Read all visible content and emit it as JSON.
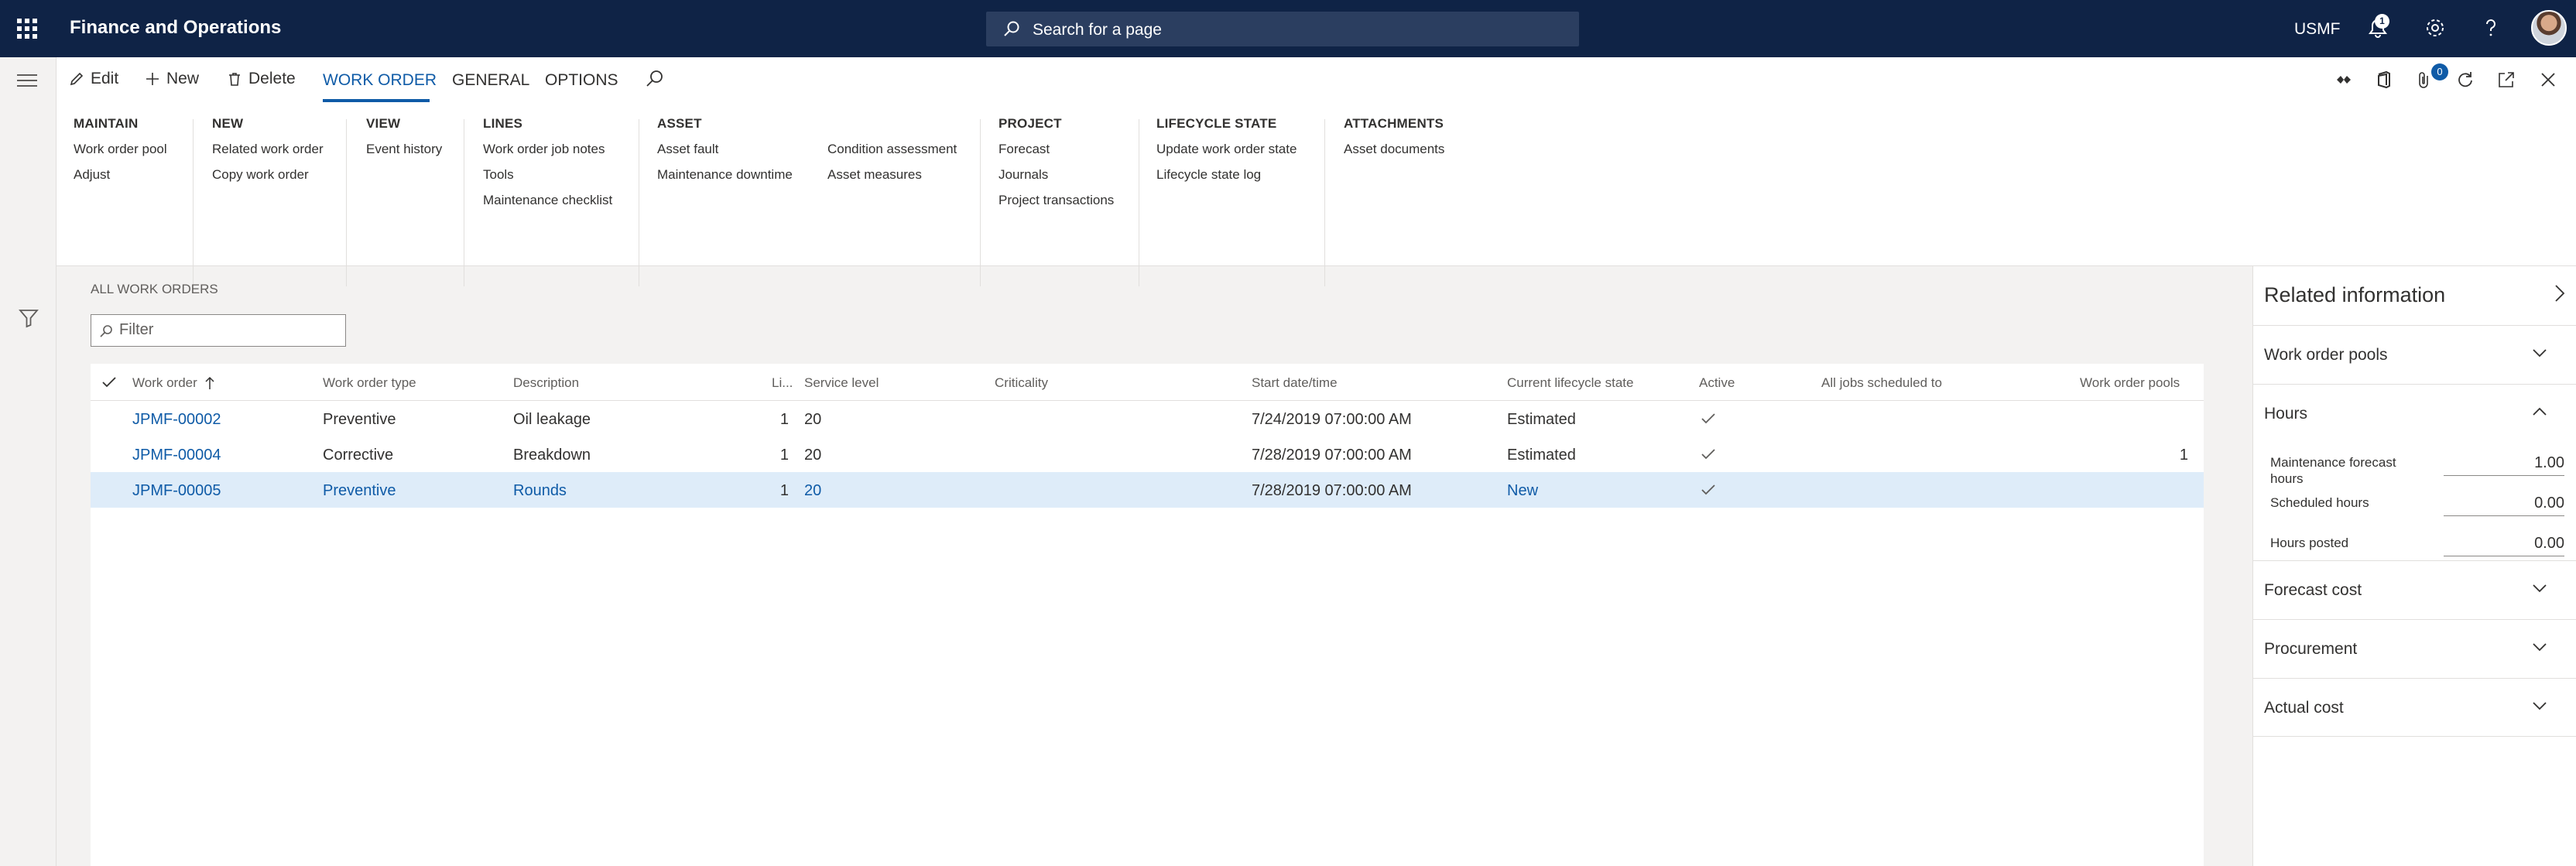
{
  "app": {
    "title": "Finance and Operations",
    "company": "USMF",
    "notification_count": "1"
  },
  "search": {
    "placeholder": "Search for a page"
  },
  "actions": {
    "edit": "Edit",
    "new": "New",
    "delete": "Delete",
    "attach_count": "0"
  },
  "tabs": [
    {
      "label": "WORK ORDER",
      "active": true
    },
    {
      "label": "GENERAL",
      "active": false
    },
    {
      "label": "OPTIONS",
      "active": false
    }
  ],
  "ribbon": [
    {
      "header": "MAINTAIN",
      "items": [
        "Work order pool",
        "Adjust"
      ]
    },
    {
      "header": "NEW",
      "items": [
        "Related work order",
        "Copy work order"
      ]
    },
    {
      "header": "VIEW",
      "items": [
        "Event history"
      ]
    },
    {
      "header": "LINES",
      "items": [
        "Work order job notes",
        "Tools",
        "Maintenance checklist"
      ]
    },
    {
      "header": "ASSET",
      "items": [
        "Asset fault",
        "Maintenance downtime"
      ],
      "items2": [
        "Condition assessment",
        "Asset measures"
      ]
    },
    {
      "header": "PROJECT",
      "items": [
        "Forecast",
        "Journals",
        "Project transactions"
      ]
    },
    {
      "header": "LIFECYCLE STATE",
      "items": [
        "Update work order state",
        "Lifecycle state log"
      ]
    },
    {
      "header": "ATTACHMENTS",
      "items": [
        "Asset documents"
      ]
    }
  ],
  "list": {
    "caption": "ALL WORK ORDERS",
    "filter_placeholder": "Filter",
    "columns": [
      "Work order",
      "Work order type",
      "Description",
      "Li...",
      "Service level",
      "Criticality",
      "Start date/time",
      "Current lifecycle state",
      "Active",
      "All jobs scheduled to",
      "Work order pools"
    ],
    "rows": [
      {
        "work_order": "JPMF-00002",
        "type": "Preventive",
        "description": "Oil leakage",
        "lines": "1",
        "service_level": "20",
        "criticality": "",
        "start": "7/24/2019 07:00:00 AM",
        "state": "Estimated",
        "active": true,
        "scheduled": "",
        "pools": "",
        "selected": false
      },
      {
        "work_order": "JPMF-00004",
        "type": "Corrective",
        "description": "Breakdown",
        "lines": "1",
        "service_level": "20",
        "criticality": "",
        "start": "7/28/2019 07:00:00 AM",
        "state": "Estimated",
        "active": true,
        "scheduled": "",
        "pools": "1",
        "selected": false
      },
      {
        "work_order": "JPMF-00005",
        "type": "Preventive",
        "description": "Rounds",
        "lines": "1",
        "service_level": "20",
        "criticality": "",
        "start": "7/28/2019 07:00:00 AM",
        "state": "New",
        "active": true,
        "scheduled": "",
        "pools": "",
        "selected": true
      }
    ]
  },
  "related": {
    "title": "Related information",
    "sections": [
      {
        "label": "Work order pools",
        "expanded": false
      },
      {
        "label": "Hours",
        "expanded": true
      },
      {
        "label": "Forecast cost",
        "expanded": false
      },
      {
        "label": "Procurement",
        "expanded": false
      },
      {
        "label": "Actual cost",
        "expanded": false
      }
    ],
    "hours": [
      {
        "label": "Maintenance forecast hours",
        "value": "1.00"
      },
      {
        "label": "Scheduled hours",
        "value": "0.00"
      },
      {
        "label": "Hours posted",
        "value": "0.00"
      }
    ]
  },
  "colors": {
    "nav": "#0f2346",
    "accent": "#0f5ba7",
    "selected_row": "#deecf9"
  }
}
